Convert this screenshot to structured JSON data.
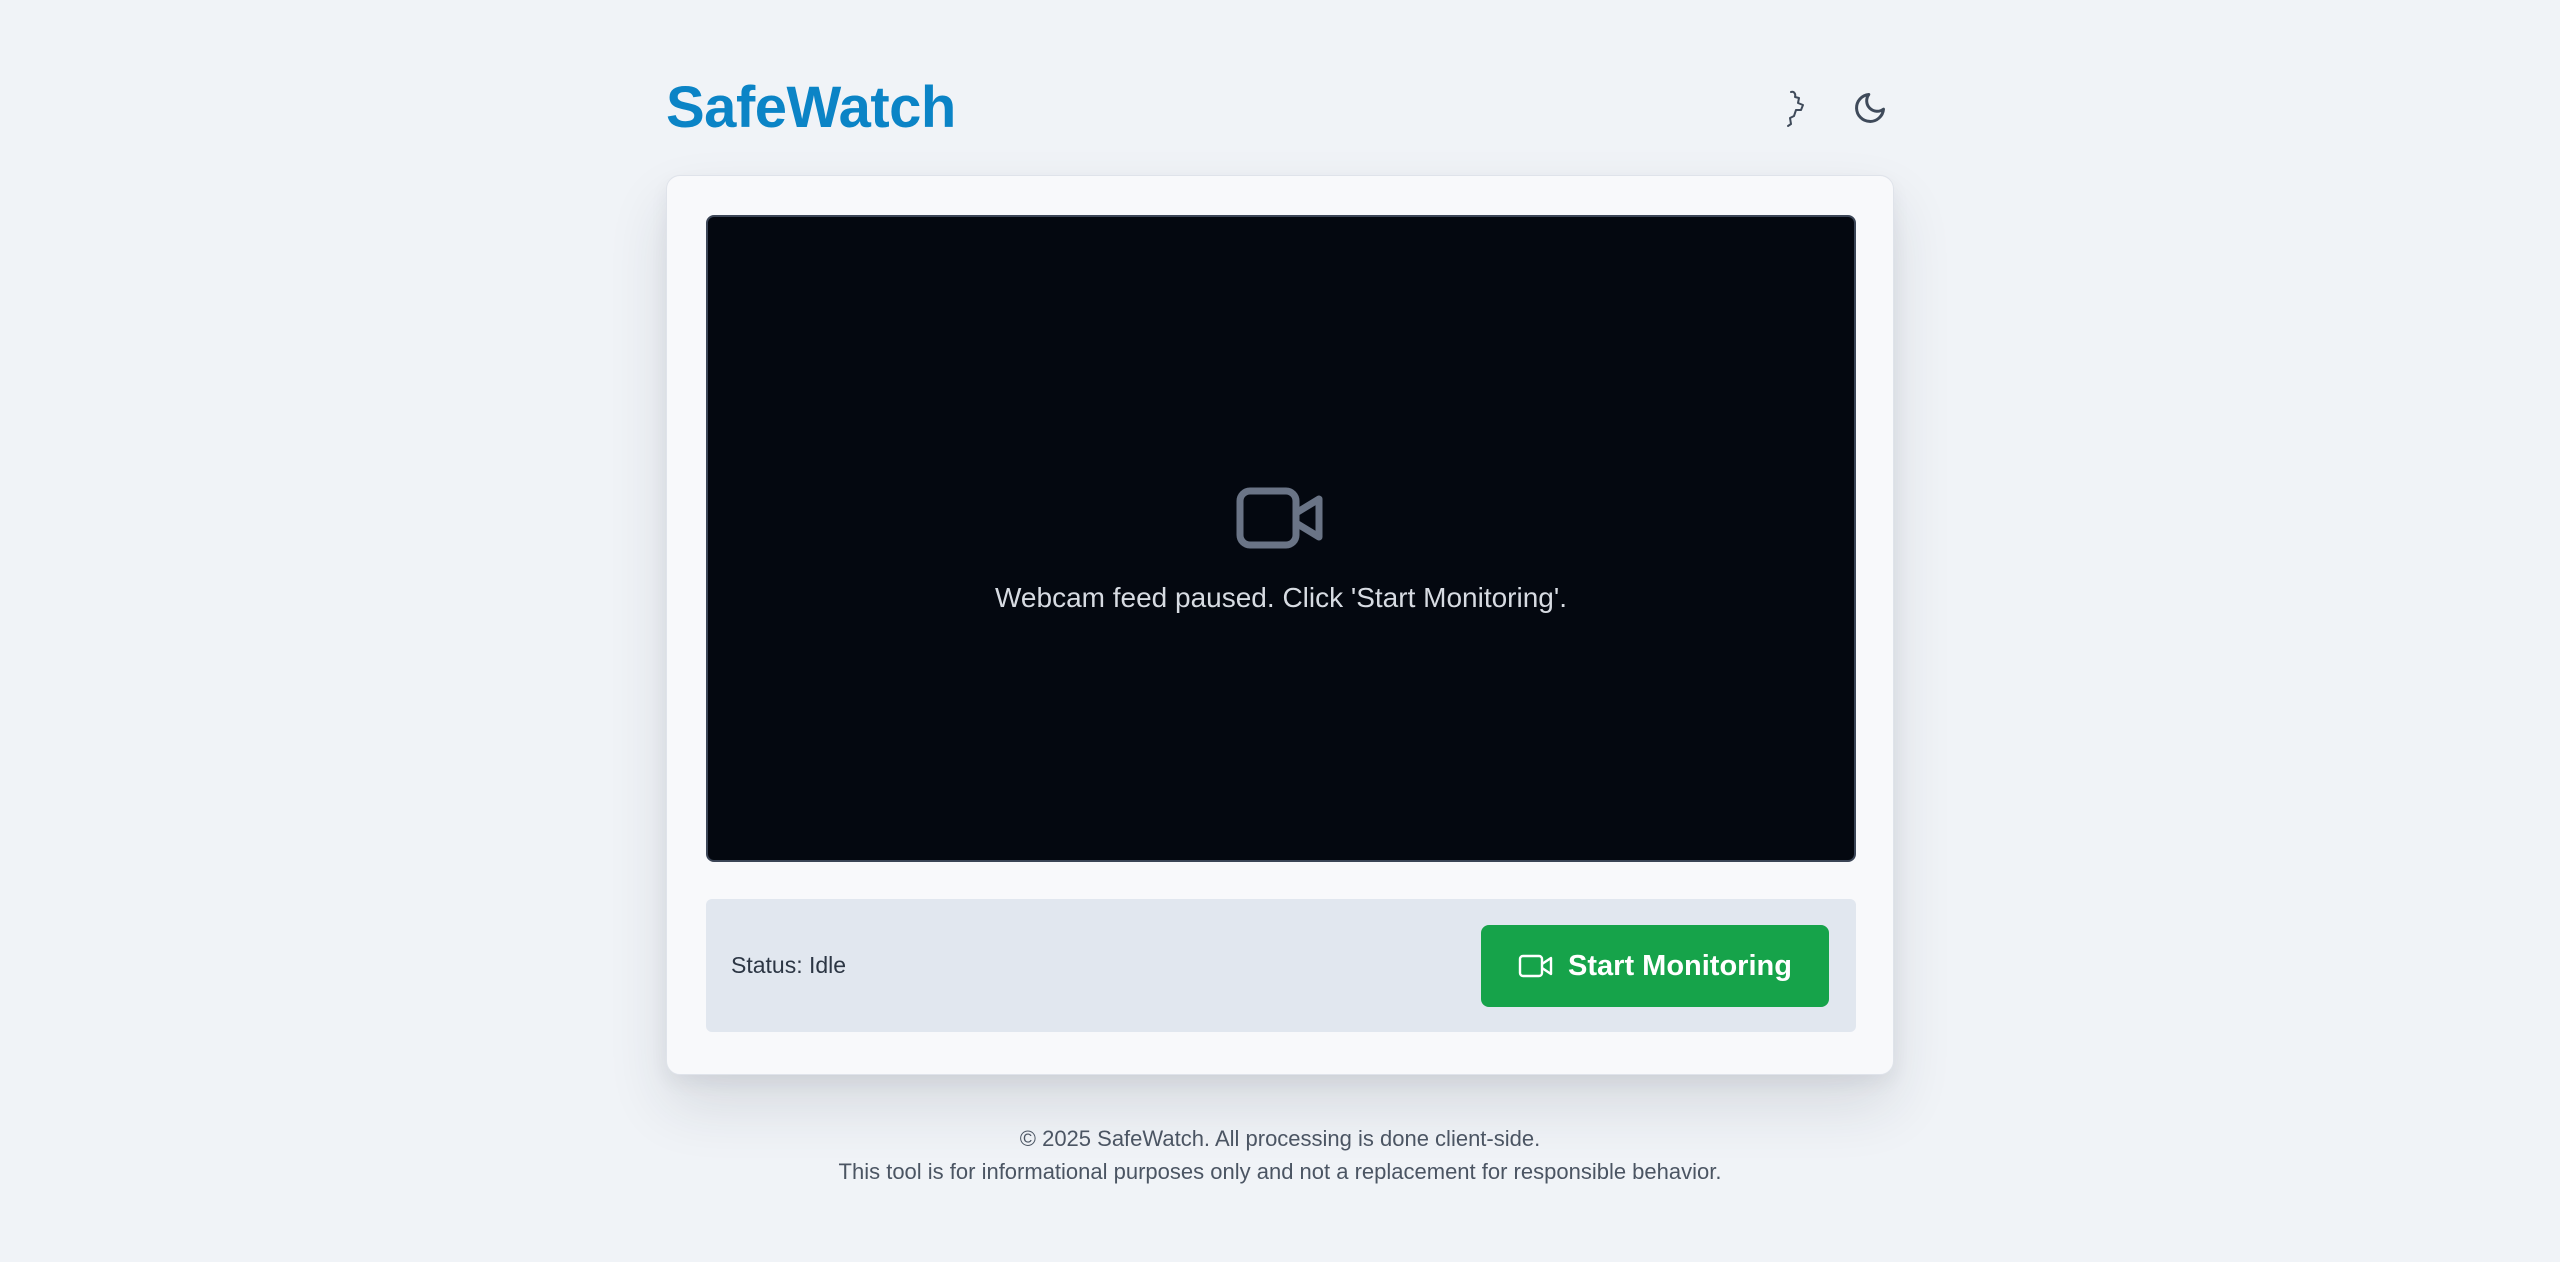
{
  "header": {
    "brand": "SafeWatch",
    "icons": {
      "accessibility": "accessibility-icon",
      "theme": "moon-icon"
    }
  },
  "video": {
    "placeholder_icon": "video-camera-icon",
    "message": "Webcam feed paused. Click 'Start Monitoring'."
  },
  "controls": {
    "status": "Status: Idle",
    "start_button": {
      "icon": "video-camera-icon",
      "label": "Start Monitoring"
    }
  },
  "footer": {
    "line1": "© 2025 SafeWatch. All processing is done client-side.",
    "line2": "This tool is for informational purposes only and not a replacement for responsible behavior."
  },
  "colors": {
    "brand": "#0b84c6",
    "background": "#f0f3f7",
    "video_bg": "#040810",
    "button": "#16a34a",
    "controls_bg": "#e1e7ef"
  }
}
